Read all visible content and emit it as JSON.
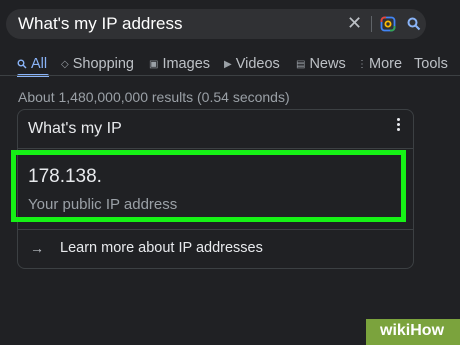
{
  "search": {
    "query": "What's my IP address"
  },
  "tabs": [
    {
      "label": "All",
      "icon": "search-icon"
    },
    {
      "label": "Shopping",
      "icon": "tag-icon"
    },
    {
      "label": "Images",
      "icon": "image-icon"
    },
    {
      "label": "Videos",
      "icon": "video-icon"
    },
    {
      "label": "News",
      "icon": "news-icon"
    },
    {
      "label": "More",
      "icon": "more-vert-icon"
    },
    {
      "label": "Tools"
    }
  ],
  "stats": "About 1,480,000,000 results (0.54 seconds)",
  "card": {
    "title": "What's my IP",
    "ip": "178.138.",
    "caption": "Your public IP address",
    "learn_more": "Learn more about IP addresses"
  },
  "watermark": "wikiHow",
  "colors": {
    "highlight": "#16f216",
    "accent": "#8ab4f8",
    "background": "#202124"
  }
}
